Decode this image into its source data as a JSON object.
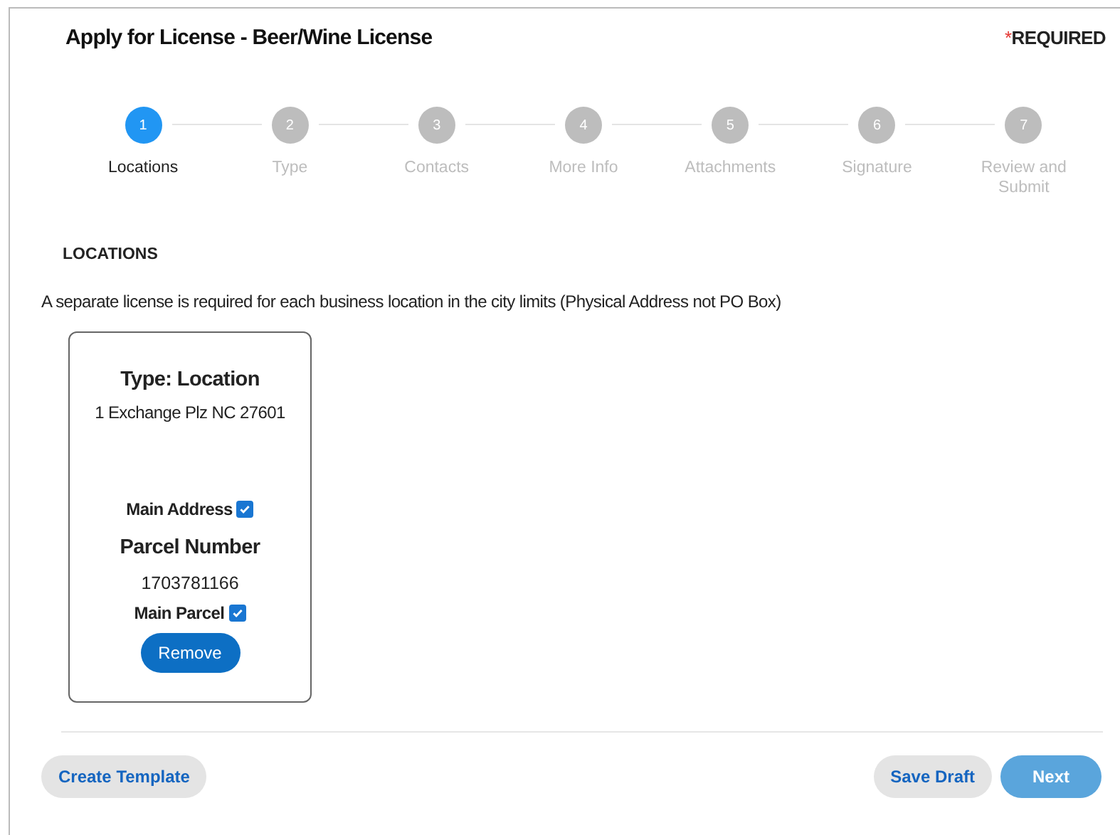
{
  "header": {
    "title": "Apply for License - Beer/Wine License",
    "required_mark": "*",
    "required_label": "REQUIRED"
  },
  "steps": [
    {
      "number": "1",
      "label": "Locations",
      "selected": true
    },
    {
      "number": "2",
      "label": "Type",
      "selected": false
    },
    {
      "number": "3",
      "label": "Contacts",
      "selected": false
    },
    {
      "number": "4",
      "label": "More Info",
      "selected": false
    },
    {
      "number": "5",
      "label": "Attachments",
      "selected": false
    },
    {
      "number": "6",
      "label": "Signature",
      "selected": false
    },
    {
      "number": "7",
      "label": "Review and Submit",
      "selected": false
    }
  ],
  "section": {
    "heading": "LOCATIONS",
    "description": "A separate license is required for each business location in the city limits (Physical Address not PO Box)"
  },
  "locations": [
    {
      "type_label": "Type: Location",
      "address": "1 Exchange Plz NC 27601",
      "main_address_label": "Main Address",
      "main_address": true,
      "parcel_heading": "Parcel Number",
      "parcel_number": "1703781166",
      "main_parcel_label": "Main Parcel",
      "main_parcel": true,
      "remove_label": "Remove"
    }
  ],
  "footer": {
    "left_buttons": [
      {
        "label": "Create Template",
        "disabled": false
      }
    ],
    "right_buttons": [
      {
        "label": "Save Draft",
        "kind": "secondary",
        "disabled": false
      },
      {
        "label": "Next",
        "kind": "primary",
        "disabled": true
      }
    ]
  }
}
